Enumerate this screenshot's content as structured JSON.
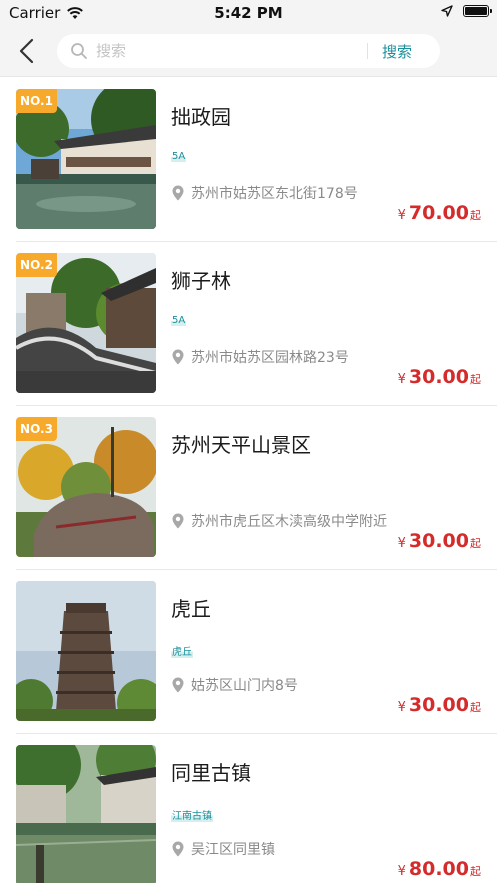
{
  "status_bar": {
    "carrier": "Carrier",
    "time": "5:42 PM"
  },
  "search": {
    "placeholder": "搜索",
    "button_label": "搜索"
  },
  "items": [
    {
      "rank": "NO.1",
      "title": "拙政园",
      "tag": "5A",
      "address": "苏州市姑苏区东北街178号",
      "currency": "¥",
      "price": "70.00",
      "price_suffix": "起"
    },
    {
      "rank": "NO.2",
      "title": "狮子林",
      "tag": "5A",
      "address": "苏州市姑苏区园林路23号",
      "currency": "¥",
      "price": "30.00",
      "price_suffix": "起"
    },
    {
      "rank": "NO.3",
      "title": "苏州天平山景区",
      "tag": "",
      "address": "苏州市虎丘区木渎高级中学附近",
      "currency": "¥",
      "price": "30.00",
      "price_suffix": "起"
    },
    {
      "rank": "",
      "title": "虎丘",
      "tag": "虎丘",
      "address": "姑苏区山门内8号",
      "currency": "¥",
      "price": "30.00",
      "price_suffix": "起"
    },
    {
      "rank": "",
      "title": "同里古镇",
      "tag": "江南古镇",
      "address": "吴江区同里镇",
      "currency": "¥",
      "price": "80.00",
      "price_suffix": "起"
    }
  ],
  "colors": {
    "accent": "#1a8f9c",
    "price": "#d42b2b",
    "rank_badge": "#f6a92a",
    "nav_bg": "#f4f4f4"
  },
  "icons": {
    "back": "chevron-left-icon",
    "search": "search-icon",
    "location": "location-pin-icon",
    "wifi": "wifi-icon",
    "battery": "battery-icon"
  }
}
